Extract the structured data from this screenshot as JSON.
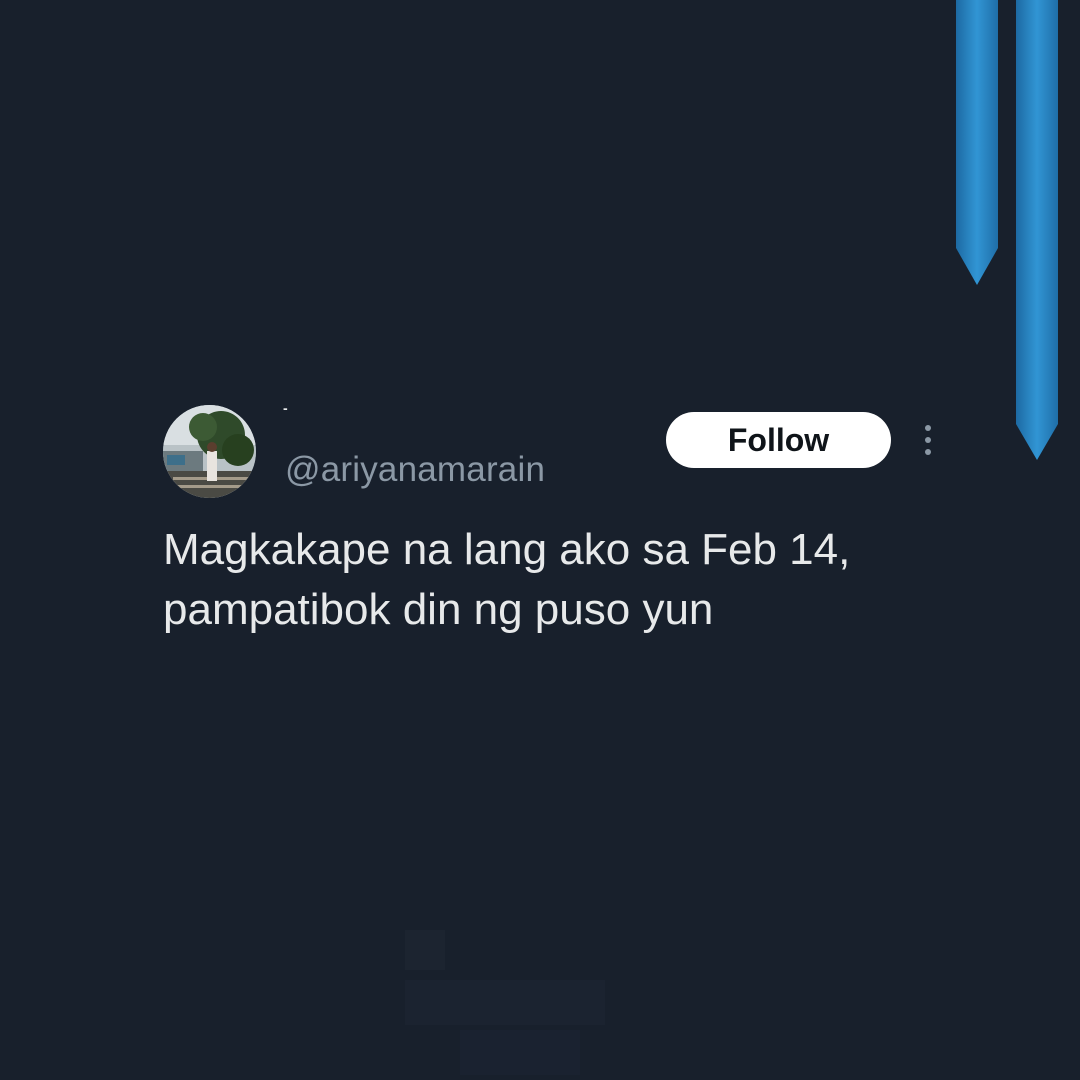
{
  "tweet": {
    "display_name": "-",
    "handle": "@ariyanamarain",
    "follow_label": "Follow",
    "text": "Magkakape na lang ako sa Feb 14,\npampatibok din ng puso yun"
  },
  "icons": {
    "more": "more-vertical-icon",
    "avatar": "profile-photo"
  },
  "colors": {
    "background": "#18202c",
    "ribbon": "#2b86c5",
    "text_primary": "#e7e9ea",
    "text_secondary": "#8b98a5",
    "follow_bg": "#ffffff"
  }
}
